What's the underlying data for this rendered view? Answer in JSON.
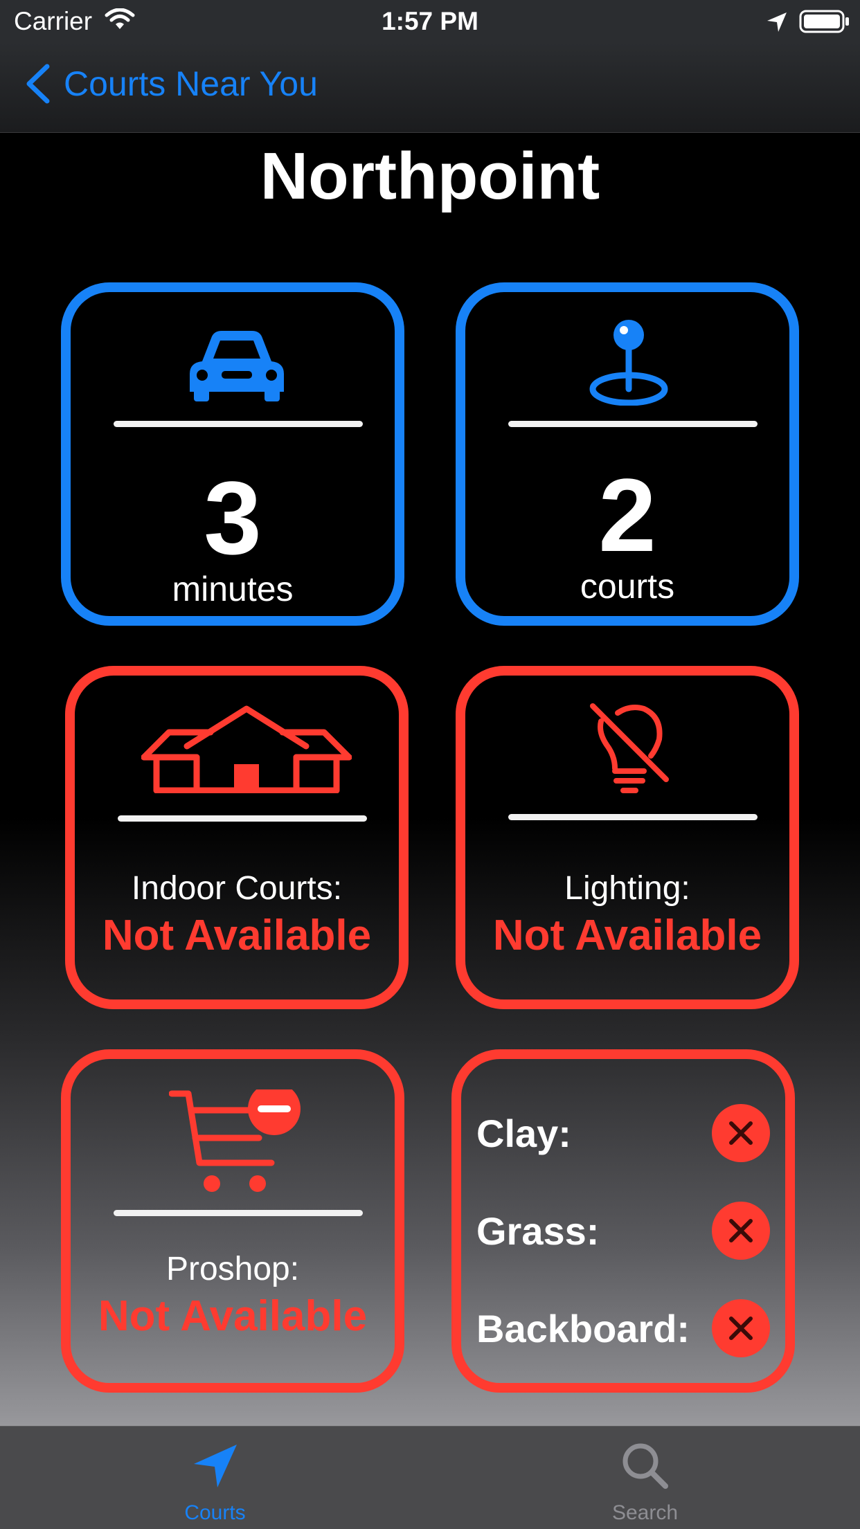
{
  "status_bar": {
    "carrier": "Carrier",
    "time": "1:57 PM"
  },
  "nav": {
    "back_label": "Courts Near You"
  },
  "page": {
    "title": "Northpoint"
  },
  "stats": {
    "drive": {
      "icon": "car-icon",
      "value": "3",
      "unit": "minutes"
    },
    "courts": {
      "icon": "map-pin-icon",
      "value": "2",
      "unit": "courts"
    }
  },
  "features": {
    "indoor": {
      "icon": "house-icon",
      "label": "Indoor Courts:",
      "status": "Not Available"
    },
    "lighting": {
      "icon": "lightbulb-slash-icon",
      "label": "Lighting:",
      "status": "Not Available"
    },
    "proshop": {
      "icon": "cart-minus-icon",
      "label": "Proshop:",
      "status": "Not Available"
    }
  },
  "surfaces": [
    {
      "label": "Clay:",
      "available": false
    },
    {
      "label": "Grass:",
      "available": false
    },
    {
      "label": "Backboard:",
      "available": false
    }
  ],
  "tabs": [
    {
      "label": "Courts",
      "icon": "location-arrow-icon",
      "selected": true
    },
    {
      "label": "Search",
      "icon": "magnifier-icon",
      "selected": false
    }
  ],
  "colors": {
    "accent_blue": "#1782f7",
    "alert_red": "#ff3b30",
    "tab_inactive": "#8e8e93"
  }
}
